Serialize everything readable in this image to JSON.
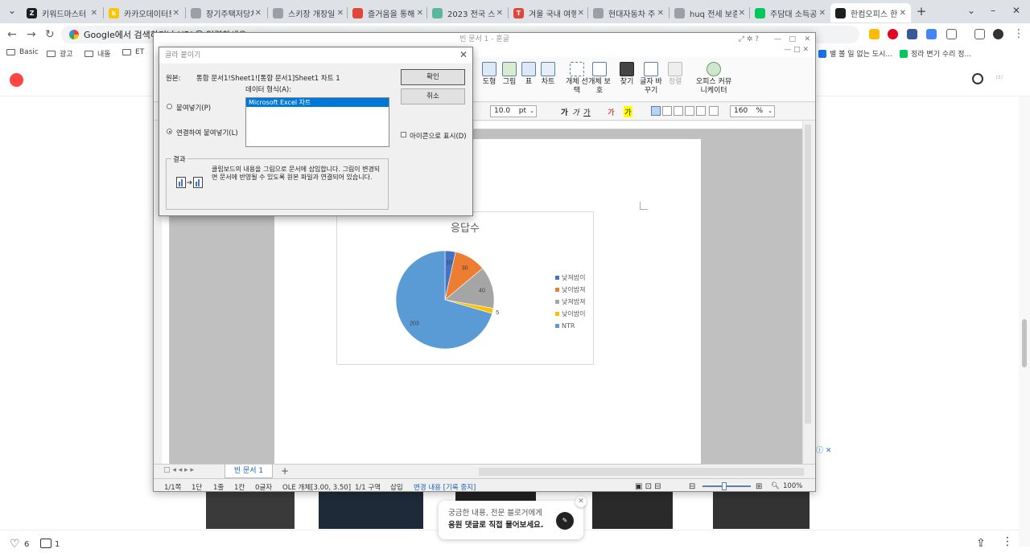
{
  "browser": {
    "tabs": [
      {
        "title": "키워드마스터",
        "color": "#1e1e1e",
        "letter": "Z"
      },
      {
        "title": "카카오데이터트",
        "color": "#f9c400",
        "letter": "k"
      },
      {
        "title": "장기주택저당차",
        "color": "#9aa0a6",
        "letter": ""
      },
      {
        "title": "스키장 개장일",
        "color": "#9aa0a6",
        "letter": ""
      },
      {
        "title": "즐거움을 통해",
        "color": "#e0453a",
        "letter": ""
      },
      {
        "title": "2023 전국 스키",
        "color": "#5ab7a0",
        "letter": ""
      },
      {
        "title": "겨울 국내 여행",
        "color": "#e0453a",
        "letter": "T"
      },
      {
        "title": "현대자동차 주",
        "color": "#9aa0a6",
        "letter": ""
      },
      {
        "title": "huq 전세 보증",
        "color": "#9aa0a6",
        "letter": ""
      },
      {
        "title": "주담대 소득공",
        "color": "#03c75a",
        "letter": ""
      },
      {
        "title": "한컴오피스 한",
        "color": "#1e1e1e",
        "letter": ""
      }
    ],
    "omnibox_text": "Google에서 검색하거나 URL을 입력하세요",
    "bookmarks": [
      {
        "label": "Basic",
        "type": "folder"
      },
      {
        "label": "광고",
        "type": "folder"
      },
      {
        "label": "내돌",
        "type": "folder"
      },
      {
        "label": "ET",
        "type": "folder"
      },
      {
        "label": "별 볼 일 없는 도시...",
        "type": "link",
        "color": "#1a73e8"
      },
      {
        "label": "정라 변기 수리 정...",
        "type": "link",
        "color": "#03c75a"
      }
    ]
  },
  "hwp": {
    "window_title": "빈 문서 1 - 훈글",
    "ribbon": [
      {
        "label": "도형",
        "dim": false
      },
      {
        "label": "그림",
        "dim": false
      },
      {
        "label": "표",
        "dim": false
      },
      {
        "label": "차트",
        "dim": false
      },
      {
        "label": "개체 선택",
        "dim": false
      },
      {
        "label": "개체 보호",
        "dim": false
      },
      {
        "label": "찾기",
        "dim": false
      },
      {
        "label": "글자 바꾸기",
        "dim": false
      },
      {
        "label": "정렬",
        "dim": true
      }
    ],
    "ribbon_office": "오피스 커뮤니케이터",
    "font_size": "10.0",
    "font_unit": "pt",
    "zoom_value": "160",
    "zoom_unit": "%",
    "doc_tab": "빈 문서 1",
    "status": {
      "page": "1/1쪽",
      "section": "1단",
      "line": "1줄",
      "col": "1칸",
      "chars": "0글자",
      "object": "OLE 개체[3.00, 3.50]",
      "area": "1/1 구역",
      "insert": "삽입",
      "track": "변경 내용 [기록 중지]",
      "zoom": "100%"
    }
  },
  "dialog": {
    "title": "골라 붙이기",
    "source_label": "원본:",
    "source_value": "통합 문서1!Sheet1![통합 문서1]Sheet1 차트 1",
    "format_label": "데이터 형식(A):",
    "format_selected": "Microsoft Excel 차트",
    "paste_option": "붙여넣기(P)",
    "paste_link_option": "연결하여 붙여넣기(L)",
    "ok_label": "확인",
    "cancel_label": "취소",
    "display_icon_label": "아이콘으로 표시(D)",
    "result_label": "결과",
    "result_text": "클립보드의 내용을 그림으로 문서에 삽입합니다. 그림이 변경되면 문서에 반영될 수 있도록 원본 파일과 연결되어 있습니다."
  },
  "chart_data": {
    "type": "pie",
    "title": "응답수",
    "categories": [
      "낮져밤이",
      "낮이밤져",
      "낮져밤져",
      "낮이밤이",
      "NTR"
    ],
    "values": [
      10,
      30,
      40,
      5,
      203
    ],
    "colors": [
      "#4472c4",
      "#ed7d31",
      "#a5a5a5",
      "#ffc000",
      "#5b9bd5"
    ],
    "legend_position": "right"
  },
  "page": {
    "like_count": "6",
    "comment_count": "1",
    "chat_line1": "궁금한 내용, 전문 블로거에게",
    "chat_line2": "응원 댓글로 직접 물어보세요."
  }
}
